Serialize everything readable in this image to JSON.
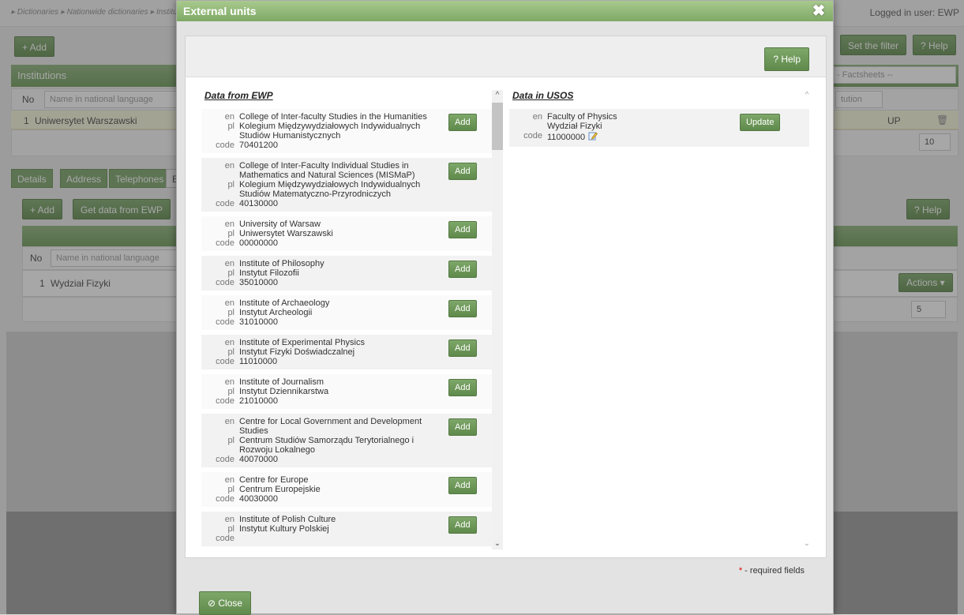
{
  "background": {
    "breadcrumb": "▸ Dictionaries ▸ Nationwide dictionaries ▸ Instituti",
    "logged_user": "Logged in user: EWP",
    "add_label": "+ Add",
    "set_filter_label": "Set the filter",
    "help_label": "? Help",
    "institutions_title": "Institutions",
    "factsheets_label": "- Factsheets --",
    "no_label": "No",
    "name_placeholder": "Name in national language",
    "institution_row": {
      "no": "1",
      "name": "Uniwersytet Warszawski",
      "code": "UP"
    },
    "page_size_1": "10",
    "tabs": [
      "Details",
      "Address",
      "Telephones",
      "E"
    ],
    "add_label_2": "+ Add",
    "get_data_label": "Get data from EWP",
    "help_label_2": "? Help",
    "no_label_2": "No",
    "name_placeholder_2": "Name in national language",
    "unit_row": {
      "no": "1",
      "name": "Wydział Fizyki"
    },
    "actions_label": "Actions ▾",
    "page_size_2": "5",
    "institution_small": "tution"
  },
  "modal": {
    "title": "External units",
    "help_label": "? Help",
    "left_header": "Data from EWP",
    "right_header": "Data in USOS",
    "add_label": "Add",
    "update_label": "Update",
    "required_star": "*",
    "required_text": " - required fields",
    "close_label": "⊘ Close",
    "ewp_entries": [
      {
        "en": "College of Inter-faculty Studies in the Humanities",
        "pl": "Kolegium Międzywydziałowych Indywidualnych Studiów Humanistycznych",
        "code": "70401200"
      },
      {
        "en": "College of Inter-Faculty Individual Studies in Mathematics and Natural Sciences (MISMaP)",
        "pl": "Kolegium Międzywydziałowych Indywidualnych Studiów Matematyczno-Przyrodniczych",
        "code": "40130000"
      },
      {
        "en": "University of Warsaw",
        "pl": "Uniwersytet Warszawski",
        "code": "00000000"
      },
      {
        "en": "Institute of Philosophy",
        "pl": "Instytut Filozofii",
        "code": "35010000"
      },
      {
        "en": "Institute of Archaeology",
        "pl": "Instytut Archeologii",
        "code": "31010000"
      },
      {
        "en": "Institute of Experimental Physics",
        "pl": "Instytut Fizyki Doświadczalnej",
        "code": "11010000"
      },
      {
        "en": "Institute of Journalism",
        "pl": "Instytut Dziennikarstwa",
        "code": "21010000"
      },
      {
        "en": "Centre for Local Government and Development Studies",
        "pl": "Centrum Studiów Samorządu Terytorialnego i Rozwoju Lokalnego",
        "code": "40070000"
      },
      {
        "en": "Centre for Europe",
        "pl": "Centrum Europejskie",
        "code": "40030000"
      },
      {
        "en": "Institute of Polish Culture",
        "pl": "Instytut Kultury Polskiej",
        "code": ""
      }
    ],
    "usos_entry": {
      "en": "Faculty of Physics",
      "pl": "Wydział Fizyki",
      "code": "11000000"
    },
    "lang_en": "en",
    "lang_pl": "pl",
    "lang_code": "code"
  }
}
